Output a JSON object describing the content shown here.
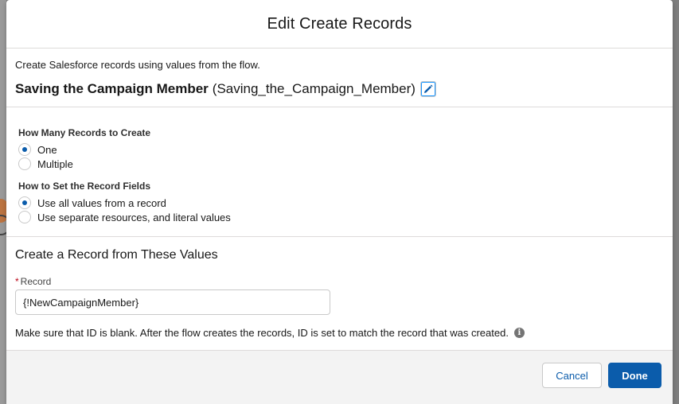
{
  "modal": {
    "title": "Edit Create Records"
  },
  "intro": {
    "description": "Create Salesforce records using values from the flow.",
    "element_label": "Saving the Campaign Member",
    "element_api_name": "(Saving_the_Campaign_Member)"
  },
  "how_many": {
    "label": "How Many Records to Create",
    "options": [
      {
        "label": "One",
        "checked": true
      },
      {
        "label": "Multiple",
        "checked": false
      }
    ]
  },
  "how_to_set": {
    "label": "How to Set the Record Fields",
    "options": [
      {
        "label": "Use all values from a record",
        "checked": true
      },
      {
        "label": "Use separate resources, and literal values",
        "checked": false
      }
    ]
  },
  "values": {
    "title": "Create a Record from These Values",
    "record_label": "Record",
    "required_mark": "*",
    "record_value": "{!NewCampaignMember}",
    "help_text": "Make sure that ID is blank. After the flow creates the records, ID is set to match the record that was created."
  },
  "footer": {
    "cancel_label": "Cancel",
    "done_label": "Done"
  },
  "colors": {
    "brand": "#0b5cab",
    "border": "#dddbda",
    "required": "#ba0517"
  },
  "icons": {
    "edit": "pencil-icon",
    "info": "info-icon"
  }
}
